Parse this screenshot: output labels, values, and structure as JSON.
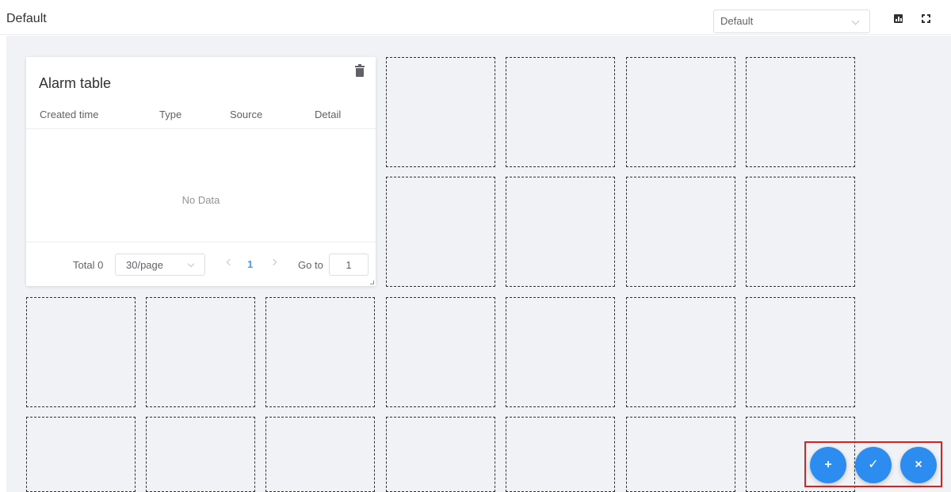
{
  "header": {
    "title": "Default",
    "dashboard_select": {
      "value": "Default"
    },
    "icons": [
      "chart-icon",
      "fullscreen-icon"
    ]
  },
  "widget": {
    "title": "Alarm table",
    "columns": [
      "Created time",
      "Type",
      "Source",
      "Detail"
    ],
    "empty_text": "No Data",
    "pagination": {
      "total_label": "Total 0",
      "page_size": "30/page",
      "current_page": "1",
      "goto_label": "Go to",
      "goto_value": "1"
    }
  },
  "actions": {
    "add": "+",
    "confirm": "✓",
    "cancel": "×"
  },
  "colors": {
    "accent": "#2d8cf0",
    "highlight_frame": "#e02020",
    "canvas_bg": "#f0f2f5"
  }
}
